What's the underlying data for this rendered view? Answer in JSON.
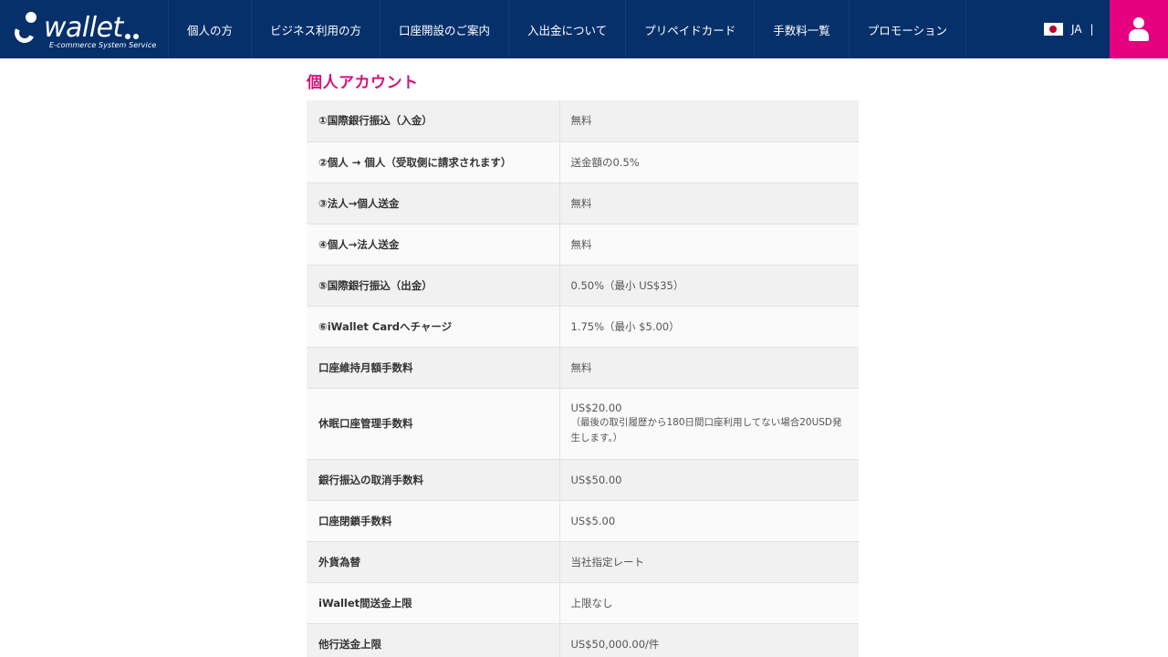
{
  "header": {
    "logo": {
      "word": "wallet",
      "tagline": "E-commerce System Service"
    },
    "nav": [
      "個人の方",
      "ビジネス利用の方",
      "口座開設のご案内",
      "入出金について",
      "プリペイドカード",
      "手数料一覧",
      "プロモーション"
    ],
    "language": {
      "code": "JA",
      "separator": "|"
    }
  },
  "content": {
    "title": "個人アカウント",
    "rows": [
      {
        "label": "①国際銀行振込（入金）",
        "value": "無料"
      },
      {
        "label": "②個人 → 個人（受取側に請求されます）",
        "value": "送金額の0.5%"
      },
      {
        "label": "③法人→個人送金",
        "value": "無料"
      },
      {
        "label": "④個人→法人送金",
        "value": "無料"
      },
      {
        "label": "⑤国際銀行振込（出金）",
        "value": "0.50%（最小 US$35）"
      },
      {
        "label": "⑥iWallet Cardへチャージ",
        "value": "1.75%（最小 $5.00）"
      },
      {
        "label": "口座維持月額手数料",
        "value": "無料"
      },
      {
        "label": "休眠口座管理手数料",
        "value": "US$20.00",
        "note": "（最後の取引履歴から180日間口座利用してない場合20USD発生します。）"
      },
      {
        "label": "銀行振込の取消手数料",
        "value": "US$50.00"
      },
      {
        "label": "口座閉鎖手数料",
        "value": "US$5.00"
      },
      {
        "label": "外貨為替",
        "value": "当社指定レート"
      },
      {
        "label": "iWallet間送金上限",
        "value": "上限なし"
      },
      {
        "label": "他行送金上限",
        "value": "US$50,000.00/件"
      }
    ]
  }
}
